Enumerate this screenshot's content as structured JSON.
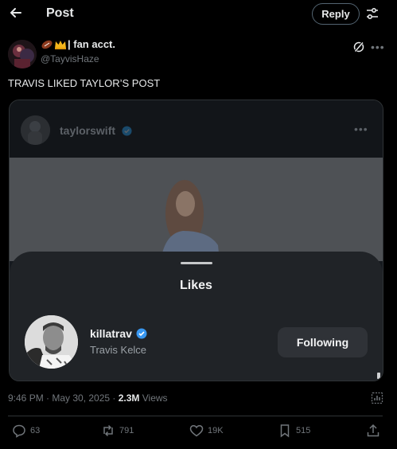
{
  "topbar": {
    "title": "Post",
    "reply_label": "Reply",
    "back_icon": "arrow-left-icon",
    "settings_icon": "sliders-icon"
  },
  "post": {
    "author_name": "| fan acct.",
    "author_emojis": [
      "football-emoji",
      "crown-emoji"
    ],
    "author_handle": "@TayvisHaze",
    "text": "TRAVIS LIKED TAYLOR’S POST",
    "timestamp": "9:46 PM · May 30, 2025 · ",
    "views_count": "2.3M",
    "views_label": " Views"
  },
  "embedded": {
    "account": "taylorswift",
    "sheet_title": "Likes",
    "liker": {
      "username": "killatrav",
      "full_name": "Travis Kelce",
      "button_label": "Following"
    }
  },
  "actions": {
    "replies": "63",
    "reposts": "791",
    "likes": "19K",
    "bookmarks": "515"
  },
  "colors": {
    "background": "#000000",
    "verified": "#1d9bf0",
    "muted": "#71767b",
    "sheet": "#202327"
  }
}
